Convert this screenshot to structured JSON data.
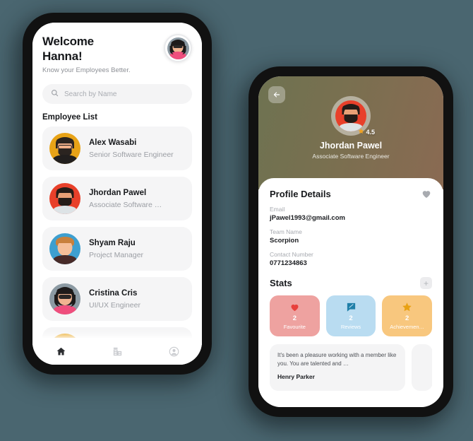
{
  "background_color": "#4a6670",
  "home": {
    "greeting_line1": "Welcome",
    "greeting_line2": "Hanna!",
    "subtitle": "Know your Employees Better.",
    "search": {
      "placeholder": "Search by Name",
      "value": "",
      "icon": "search-icon"
    },
    "user_avatar": "hanna-avatar",
    "section_title": "Employee List",
    "employees": [
      {
        "name": "Alex Wasabi",
        "role": "Senior Software Engineer",
        "avatar_bg": "#e8a317",
        "skin": "#f0b08a",
        "hair": "#2b2420",
        "shirt": "#221f1e",
        "glasses": true
      },
      {
        "name": "Jhordan Pawel",
        "role": "Associate Software …",
        "avatar_bg": "#e8402a",
        "skin": "#e8a076",
        "hair": "#241c18",
        "shirt": "#dde3e6",
        "glasses": false
      },
      {
        "name": "Shyam Raju",
        "role": "Project Manager",
        "avatar_bg": "#3d9fd0",
        "skin": "#f5bf99",
        "hair": "#c8803c",
        "shirt": "#472a28",
        "glasses": false
      },
      {
        "name": "Cristina Cris",
        "role": "UI/UX Engineer",
        "avatar_bg": "#8c9aa3",
        "skin": "#f0b491",
        "hair": "#1d1a1a",
        "shirt": "#ef4e7d",
        "glasses": true
      },
      {
        "name": "",
        "role": "",
        "avatar_bg": "#e8a317",
        "skin": "#f0b08a",
        "hair": "#2b2420",
        "shirt": "#221f1e",
        "glasses": false
      }
    ],
    "bottom_nav": [
      {
        "icon": "home-icon",
        "active": true
      },
      {
        "icon": "building-icon",
        "active": false
      },
      {
        "icon": "profile-icon",
        "active": false
      }
    ]
  },
  "profile": {
    "back_icon": "back-arrow-icon",
    "hero_gradient_start": "#6e7251",
    "hero_gradient_end": "#8a6a52",
    "name": "Jhordan Pawel",
    "role": "Associate Software Engineer",
    "rating": "4.5",
    "rating_icon": "star-icon",
    "avatar_bg": "#e8402a",
    "details_title": "Profile Details",
    "favourite_icon": "heart-icon",
    "fields": [
      {
        "label": "Email",
        "value": "jPawel1993@gmail.com"
      },
      {
        "label": "Team Name",
        "value": "Scorpion"
      },
      {
        "label": "Contact Number",
        "value": "0771234863"
      }
    ],
    "stats_title": "Stats",
    "add_stat_label": "+",
    "stats": [
      {
        "count": "2",
        "label": "Favourite",
        "color": "#eea2a0",
        "icon": "heart-icon",
        "icon_color": "#e8403c"
      },
      {
        "count": "2",
        "label": "Reviews",
        "color": "#b9dcf1",
        "icon": "review-icon",
        "icon_color": "#1f7fa8"
      },
      {
        "count": "2",
        "label": "Achievemen…",
        "color": "#f8c77e",
        "icon": "star-icon",
        "icon_color": "#e8a113"
      }
    ],
    "testimonials": [
      {
        "text": "It's been a pleasure working with a member like you. You are talented and …",
        "author": "Henry Parker"
      }
    ]
  }
}
